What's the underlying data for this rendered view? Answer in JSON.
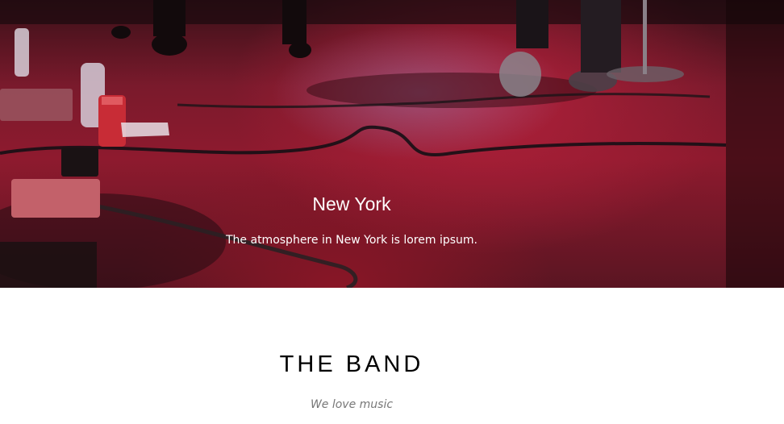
{
  "hero": {
    "title": "New York",
    "caption": "The atmosphere in New York is lorem ipsum."
  },
  "band": {
    "title": "THE BAND",
    "subtitle": "We love music"
  }
}
